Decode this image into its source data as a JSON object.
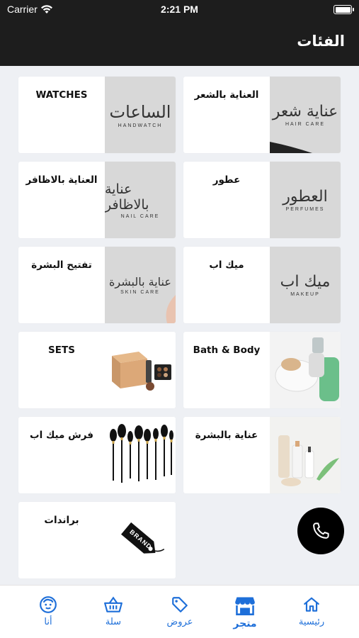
{
  "status_bar": {
    "carrier": "Carrier",
    "time": "2:21 PM"
  },
  "header": {
    "title": "الفئات"
  },
  "categories": [
    {
      "label": "العناية بالشعر",
      "image_ar": "عناية شعر",
      "image_en": "HAIR CARE"
    },
    {
      "label": "WATCHES",
      "image_ar": "الساعات",
      "image_en": "HANDWATCH"
    },
    {
      "label": "عطور",
      "image_ar": "العطور",
      "image_en": "PERFUMES"
    },
    {
      "label": "العناية بالاظافر",
      "image_ar": "عناية بالاظافر",
      "image_en": "NAIL CARE"
    },
    {
      "label": "ميك اب",
      "image_ar": "ميك اب",
      "image_en": "MAKEUP"
    },
    {
      "label": "تفتيح البشرة",
      "image_ar": "عناية بالبشرة",
      "image_en": "SKIN CARE"
    },
    {
      "label": "Bath & Body"
    },
    {
      "label": "SETS"
    },
    {
      "label": "عناية بالبشرة"
    },
    {
      "label": "فرش ميك اب"
    },
    {
      "label": "براندات",
      "image_text": "BRAND"
    }
  ],
  "tabs": [
    {
      "label": "رئيسية",
      "icon": "home-icon"
    },
    {
      "label": "متجر",
      "icon": "store-icon",
      "active": true
    },
    {
      "label": "عروض",
      "icon": "tag-icon"
    },
    {
      "label": "سلة",
      "icon": "basket-icon"
    },
    {
      "label": "أنا",
      "icon": "profile-icon"
    }
  ],
  "colors": {
    "header_bg": "#1d1d1d",
    "accent": "#1e6fd9",
    "page_bg": "#eef0f4"
  }
}
